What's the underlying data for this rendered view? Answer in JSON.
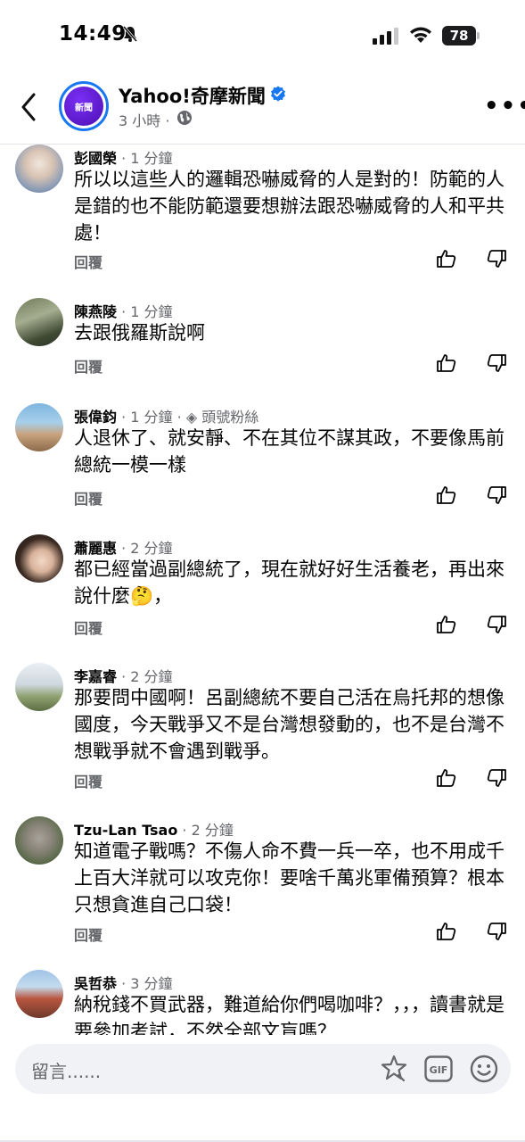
{
  "status_bar": {
    "time": "14:49",
    "battery": "78"
  },
  "header": {
    "page_name": "Yahoo!奇摩新聞",
    "avatar_label": "新聞",
    "meta_time": "3 小時 ·"
  },
  "comments": [
    {
      "name": "彭國榮",
      "time": " · 1 分鐘",
      "badge": "",
      "text": "所以以這些人的邏輯恐嚇威脅的人是對的！防範的人是錯的也不能防範還要想辦法跟恐嚇威脅的人和平共處！",
      "reply": "回覆"
    },
    {
      "name": "陳燕陵",
      "time": " · 1 分鐘",
      "badge": "",
      "text": "去跟俄羅斯說啊",
      "reply": "回覆"
    },
    {
      "name": "張偉鈞",
      "time": " · 1 分鐘 · ",
      "badge": "◈ 頭號粉絲",
      "text": "人退休了、就安靜、不在其位不謀其政，不要像馬前總統一模一樣",
      "reply": "回覆"
    },
    {
      "name": "蕭麗惠",
      "time": " · 2 分鐘",
      "badge": "",
      "text": "都已經當過副總統了，現在就好好生活養老，再出來說什麼🤔，",
      "reply": "回覆"
    },
    {
      "name": "李嘉睿",
      "time": " · 2 分鐘",
      "badge": "",
      "text": "那要問中國啊！呂副總統不要自己活在烏托邦的想像國度，今天戰爭又不是台灣想發動的，也不是台灣不想戰爭就不會遇到戰爭。",
      "reply": "回覆"
    },
    {
      "name": "Tzu-Lan Tsao",
      "time": " · 2 分鐘",
      "badge": "",
      "text": "知道電子戰嗎？不傷人命不費一兵一卒，也不用成千上百大洋就可以攻克你！要啥千萬兆軍備預算？根本只想貪進自己口袋！",
      "reply": "回覆"
    },
    {
      "name": "吳哲恭",
      "time": " · 3 分鐘",
      "badge": "",
      "text": "納稅錢不買武器，難道給你們喝咖啡？，，，讀書就是要參加考試，不然全部文盲嗎？",
      "reply": ""
    }
  ],
  "composer": {
    "placeholder": "留言......"
  },
  "colors": {
    "accent": "#1877f2",
    "secondary_text": "#65676b",
    "composer_bg": "#f0f2f5"
  },
  "icons": [
    "back-arrow-icon",
    "verified-icon",
    "globe-icon",
    "more-icon",
    "like-icon",
    "dislike-icon",
    "sticker-icon",
    "gif-icon",
    "emoji-icon"
  ]
}
